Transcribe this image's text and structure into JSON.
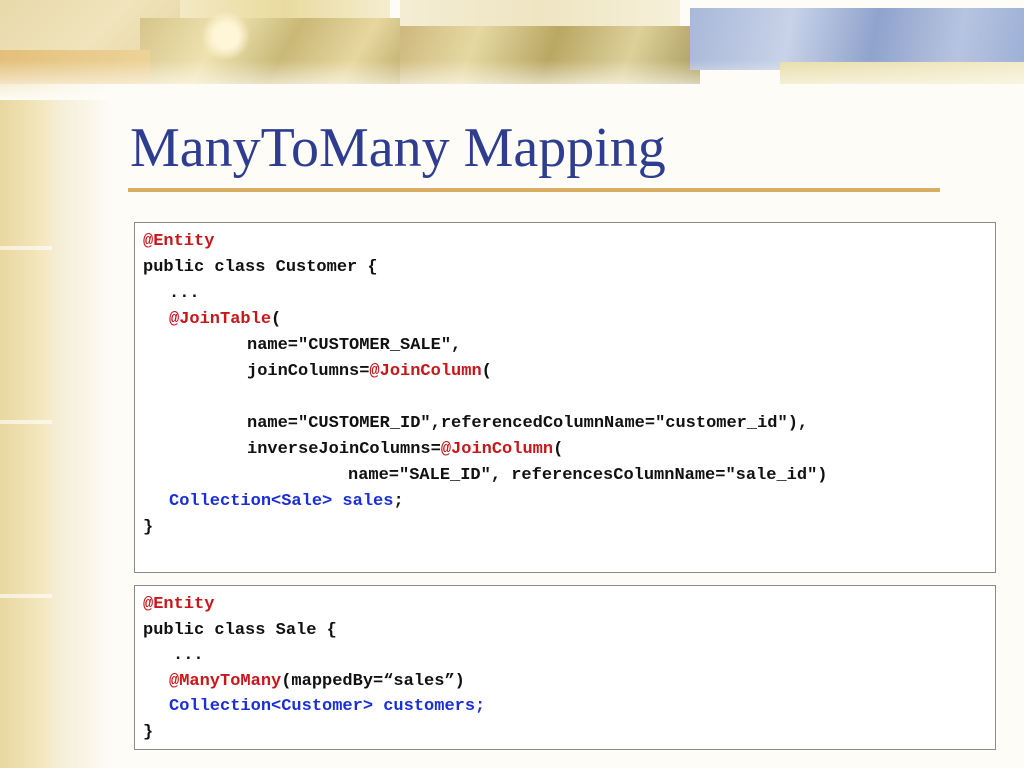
{
  "slide": {
    "title": "ManyToMany Mapping"
  },
  "customer_code": {
    "l1_ann": "@Entity",
    "l2": "public class Customer {",
    "l3": "...",
    "l4_ann": "@JoinTable",
    "l4_rest": "(",
    "l5": "name=\"CUSTOMER_SALE\",",
    "l6_pre": "joinColumns=",
    "l6_ann": "@JoinColumn",
    "l6_rest": "(",
    "l7": "name=\"CUSTOMER_ID\",referencedColumnName=\"customer_id\"),",
    "l8_pre": "inverseJoinColumns=",
    "l8_ann": "@JoinColumn",
    "l8_rest": "(",
    "l9": "name=\"SALE_ID\", referencesColumnName=\"sale_id\")",
    "l10_blue": "Collection<Sale> sales",
    "l10_rest": ";",
    "l11": "}"
  },
  "sale_code": {
    "l1_ann": "@Entity",
    "l2": "public class Sale {",
    "l3": "...",
    "l4_ann": "@ManyToMany",
    "l4_rest": "(mappedBy=“sales”)",
    "l5_blue": "Collection<Customer> customers;",
    "l6": "}"
  },
  "colors": {
    "title": "#2e3d8f",
    "rule": "#d9ad62",
    "annotation": "#c8171a",
    "type_highlight": "#1b2fd8"
  }
}
